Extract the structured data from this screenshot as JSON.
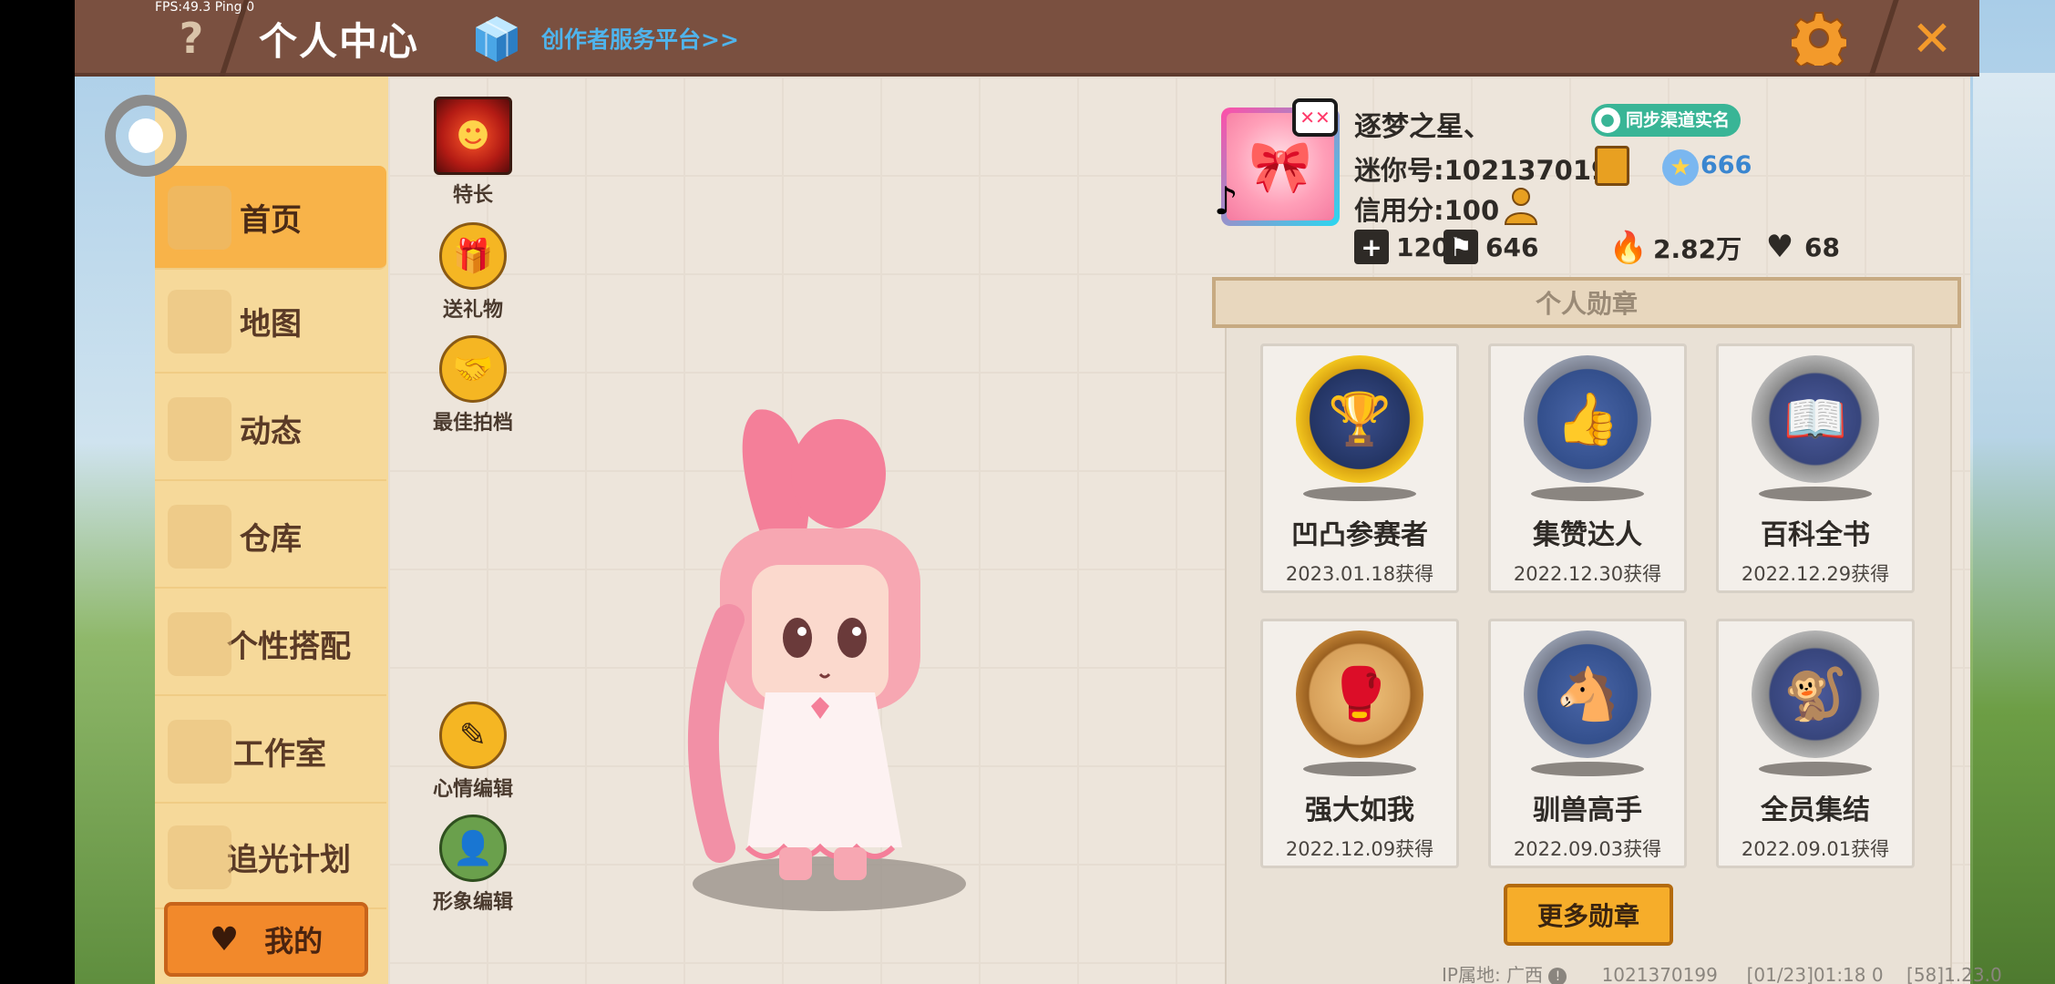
{
  "overlay": {
    "fps_text": "FPS:49.3  Ping:0"
  },
  "header": {
    "help_label": "?",
    "title": "个人中心",
    "creator_link": "创作者服务平台>>",
    "close_label": "✕"
  },
  "nav": {
    "items": [
      {
        "label": "首页",
        "active": true
      },
      {
        "label": "地图",
        "active": false
      },
      {
        "label": "动态",
        "active": false
      },
      {
        "label": "仓库",
        "active": false
      },
      {
        "label": "个性搭配",
        "active": false
      },
      {
        "label": "工作室",
        "active": false
      },
      {
        "label": "追光计划",
        "active": false
      }
    ],
    "mine_label": "我的"
  },
  "tools": {
    "talent": "特长",
    "gift": "送礼物",
    "partner": "最佳拍档",
    "mood": "心情编辑",
    "avatar_edit": "形象编辑"
  },
  "profile": {
    "nickname": "逐梦之星、",
    "sync_badge": "同步渠道实名",
    "mini_id": "迷你号:1021370199",
    "vip_value": "666",
    "credit": "信用分:100",
    "stats": {
      "bookmarks": "120",
      "fans": "646",
      "popularity": "2.82万",
      "likes": "68"
    }
  },
  "medals": {
    "header": "个人勋章",
    "items": [
      {
        "name": "凹凸参赛者",
        "date": "2023.01.18获得",
        "style": "gold"
      },
      {
        "name": "集赞达人",
        "date": "2022.12.30获得",
        "style": "steel"
      },
      {
        "name": "百科全书",
        "date": "2022.12.29获得",
        "style": "stone"
      },
      {
        "name": "强大如我",
        "date": "2022.12.09获得",
        "style": "bronze"
      },
      {
        "name": "驯兽高手",
        "date": "2022.09.03获得",
        "style": "steel"
      },
      {
        "name": "全员集结",
        "date": "2022.09.01获得",
        "style": "stone"
      }
    ],
    "more_label": "更多勋章"
  },
  "footer": {
    "ip_label": "IP属地: 广西",
    "id": "1021370199",
    "timestamp": "[01/23]01:18 0",
    "version": "[58]1.23.0"
  },
  "colors": {
    "topbar": "#7a5040",
    "nav_bg": "#f6d99a",
    "nav_active": "#f8b349",
    "accent_orange": "#f39a2b",
    "link_blue": "#4fb4ec"
  }
}
